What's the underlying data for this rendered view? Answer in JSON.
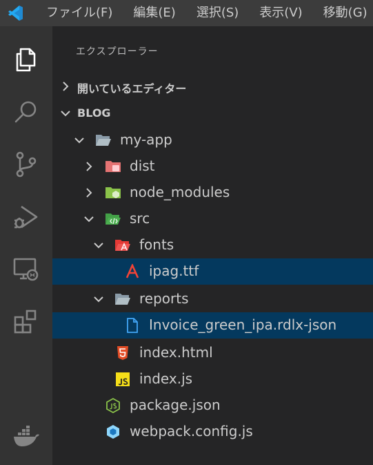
{
  "menubar": {
    "items": [
      "ファイル(F)",
      "編集(E)",
      "選択(S)",
      "表示(V)",
      "移動(G)"
    ]
  },
  "colors": {
    "menubar_bg": "#3c3c3c",
    "activitybar_bg": "#333333",
    "sidebar_bg": "#252526",
    "selection_bg": "#04395e",
    "vscode_blue": "#23a9f2"
  },
  "activitybar": {
    "icons": [
      "explorer-icon",
      "search-icon",
      "source-control-icon",
      "run-debug-icon",
      "remote-explorer-icon",
      "extensions-icon",
      "docker-icon"
    ]
  },
  "explorer": {
    "title": "エクスプローラー",
    "open_editors": "開いているエディター",
    "workspace": "BLOG",
    "tree": [
      {
        "label": "my-app",
        "depth": 0,
        "type": "folder",
        "expanded": true,
        "icon": "folder-open-icon"
      },
      {
        "label": "dist",
        "depth": 1,
        "type": "folder",
        "expanded": false,
        "icon": "folder-dist-icon"
      },
      {
        "label": "node_modules",
        "depth": 1,
        "type": "folder",
        "expanded": false,
        "icon": "folder-node-icon"
      },
      {
        "label": "src",
        "depth": 1,
        "type": "folder",
        "expanded": true,
        "icon": "folder-src-icon"
      },
      {
        "label": "fonts",
        "depth": 2,
        "type": "folder",
        "expanded": true,
        "icon": "folder-fonts-icon"
      },
      {
        "label": "ipag.ttf",
        "depth": 3,
        "type": "file",
        "selected": true,
        "icon": "font-file-icon"
      },
      {
        "label": "reports",
        "depth": 2,
        "type": "folder",
        "expanded": true,
        "icon": "folder-open-icon"
      },
      {
        "label": "Invoice_green_ipa.rdlx-json",
        "depth": 3,
        "type": "file",
        "selected": true,
        "icon": "file-icon"
      },
      {
        "label": "index.html",
        "depth": 2,
        "type": "file",
        "icon": "html-file-icon"
      },
      {
        "label": "index.js",
        "depth": 2,
        "type": "file",
        "icon": "js-file-icon"
      },
      {
        "label": "package.json",
        "depth": 1,
        "type": "file",
        "icon": "nodejs-icon"
      },
      {
        "label": "webpack.config.js",
        "depth": 1,
        "type": "file",
        "icon": "webpack-icon"
      }
    ]
  }
}
